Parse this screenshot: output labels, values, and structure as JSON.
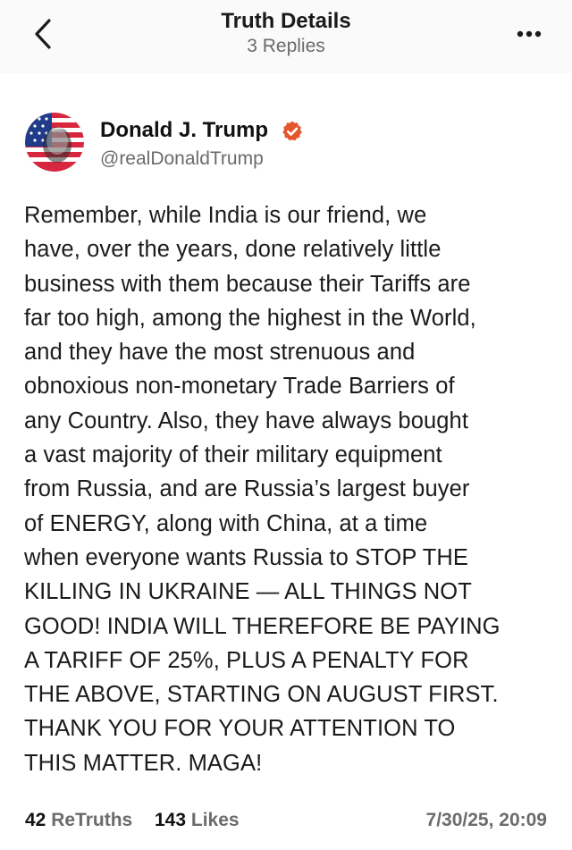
{
  "header": {
    "title": "Truth Details",
    "subtitle": "3 Replies",
    "back_icon": "chevron-left-icon",
    "more_icon": "ellipsis-icon"
  },
  "author": {
    "name": "Donald J. Trump",
    "handle": "@realDonaldTrump",
    "verified_icon": "verified-badge-icon",
    "verified_color": "#e4572e"
  },
  "post": {
    "text": "Remember, while India is our friend, we\nhave, over the years, done relatively little\nbusiness with them because their Tariffs are\nfar too high, among the highest in the World,\nand they have the most strenuous and\nobnoxious non-monetary Trade Barriers of\nany Country. Also, they have always bought\na vast majority of their military equipment\nfrom Russia, and are Russia’s largest buyer\nof ENERGY, along with China, at a time\nwhen everyone wants Russia to STOP THE\nKILLING IN UKRAINE — ALL THINGS NOT\nGOOD! INDIA WILL THEREFORE BE PAYING\nA TARIFF OF 25%, PLUS A PENALTY FOR\nTHE ABOVE, STARTING ON AUGUST FIRST.\nTHANK YOU FOR YOUR ATTENTION TO\nTHIS MATTER. MAGA!"
  },
  "stats": {
    "retruths_count": "42",
    "retruths_label": "ReTruths",
    "likes_count": "143",
    "likes_label": "Likes",
    "timestamp": "7/30/25, 20:09"
  }
}
